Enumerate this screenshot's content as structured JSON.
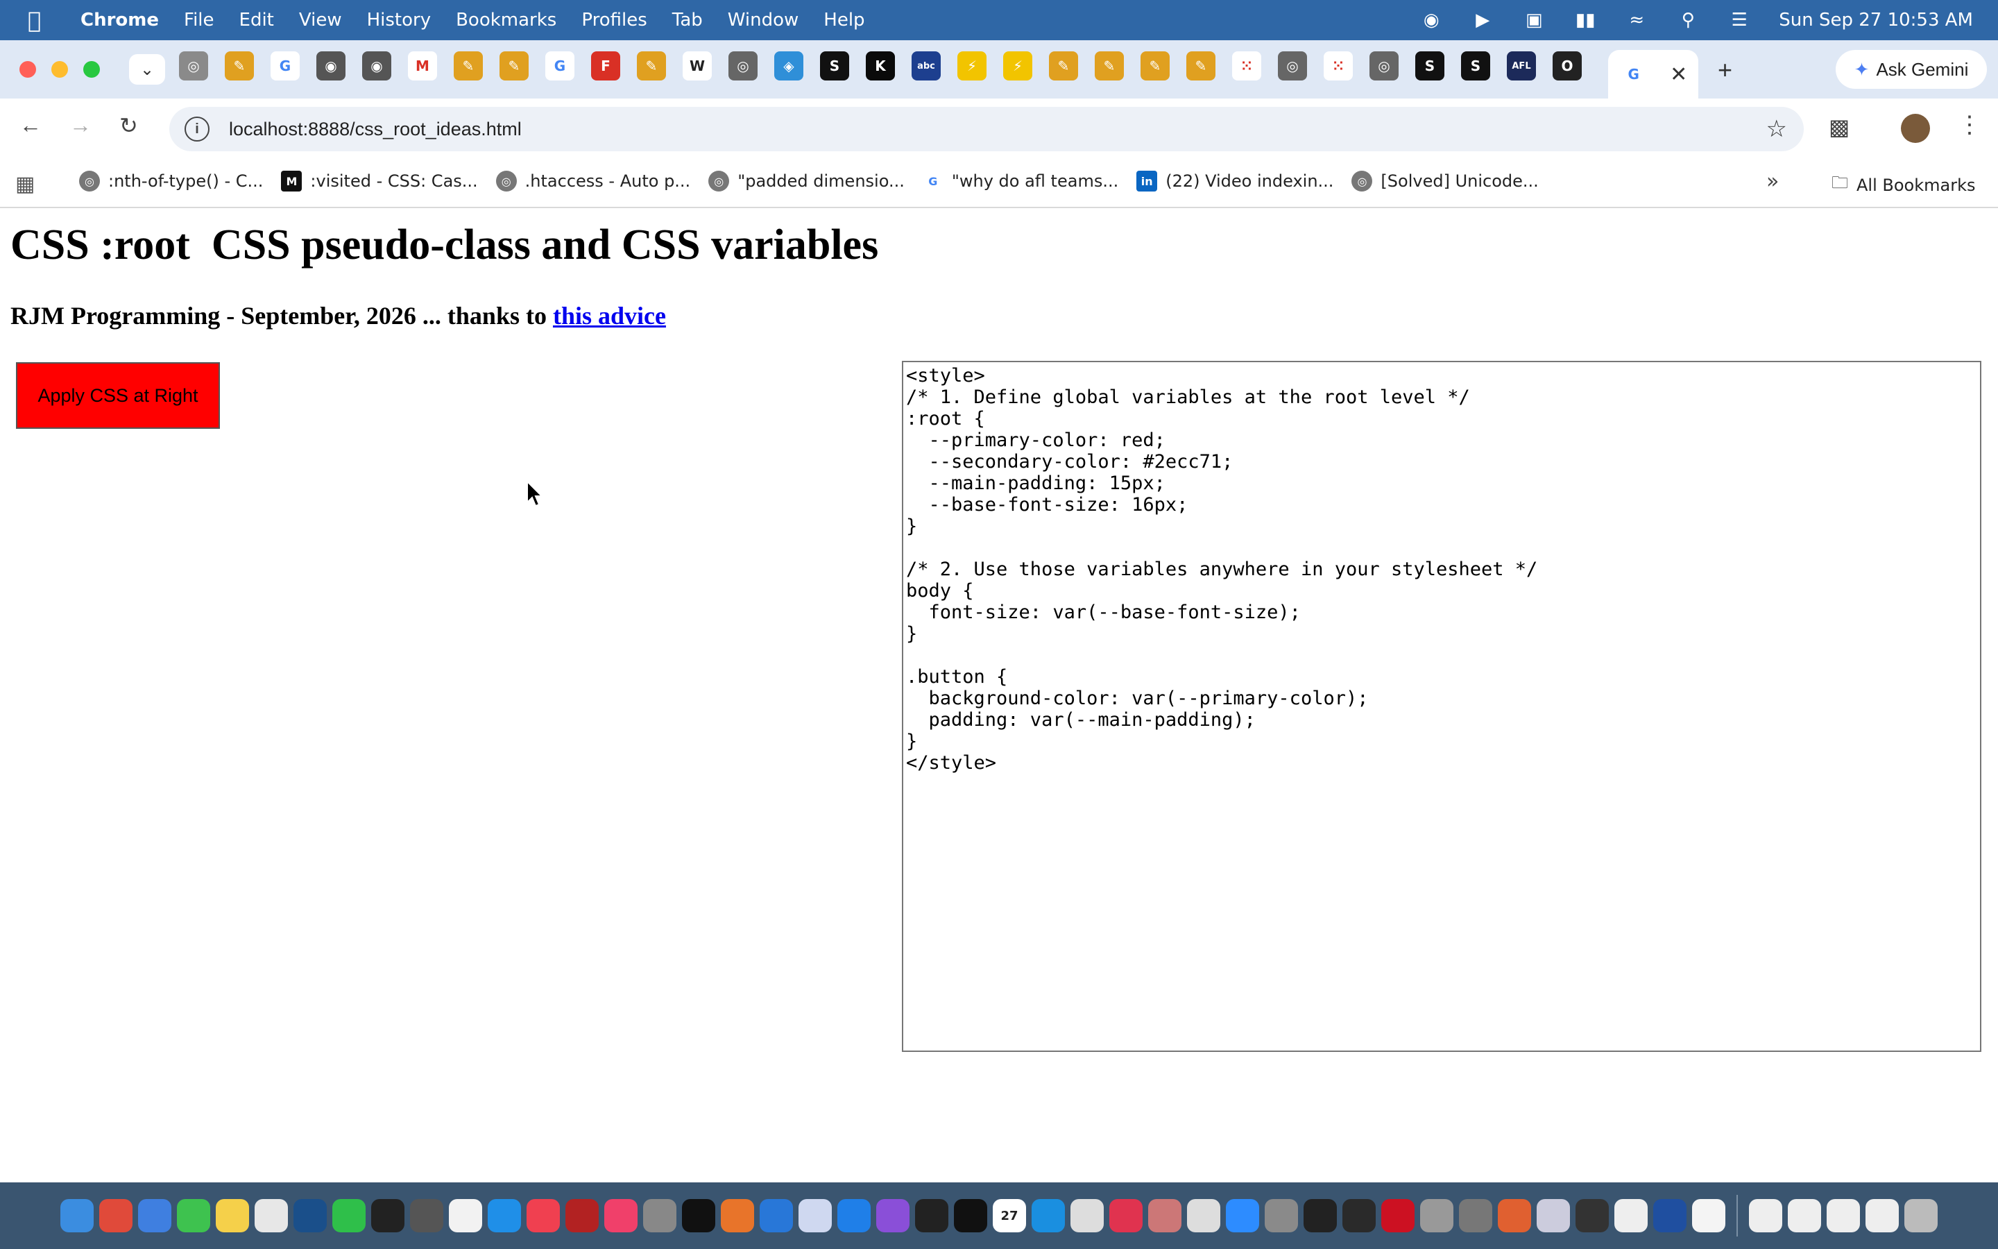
{
  "menubar": {
    "app_name": "Chrome",
    "items": [
      "File",
      "Edit",
      "View",
      "History",
      "Bookmarks",
      "Profiles",
      "Tab",
      "Window",
      "Help"
    ],
    "clock": "Sun Sep 27  10:53 AM"
  },
  "tabs": {
    "favicons": [
      "globe",
      "pencil",
      "G",
      "shield",
      "shield",
      "M",
      "pencil",
      "pencil",
      "G",
      "F",
      "pencil",
      "W",
      "chrome",
      "diamond",
      "S",
      "K",
      "abc",
      "bolt",
      "bolt",
      "pencil",
      "pencil",
      "pencil",
      "pencil",
      "dots",
      "chrome",
      "dots",
      "chrome",
      "S",
      "S",
      "AFL",
      "O",
      "G"
    ],
    "ask_gemini_label": "Ask Gemini"
  },
  "toolbar": {
    "url": "localhost:8888/css_root_ideas.html"
  },
  "bookmarks": {
    "items": [
      {
        "icon": "globe",
        "label": ":nth-of-type() - C..."
      },
      {
        "icon": "M",
        "label": ":visited - CSS: Cas..."
      },
      {
        "icon": "globe",
        "label": ".htaccess - Auto p..."
      },
      {
        "icon": "globe",
        "label": "\"padded dimensio..."
      },
      {
        "icon": "G",
        "label": "\"why do afl teams..."
      },
      {
        "icon": "in",
        "label": "(22) Video indexin..."
      },
      {
        "icon": "globe",
        "label": "[Solved] Unicode..."
      }
    ],
    "all_bookmarks_label": "All Bookmarks"
  },
  "page": {
    "title": "CSS :root  CSS pseudo-class and CSS variables",
    "byline_prefix": "RJM Programming - September, 2026 ... thanks to ",
    "byline_link": "this advice",
    "apply_button_label": "Apply CSS at Right",
    "css_textarea_value": "<style>\n/* 1. Define global variables at the root level */\n:root {\n  --primary-color: red;\n  --secondary-color: #2ecc71;\n  --main-padding: 15px;\n  --base-font-size: 16px;\n}\n\n/* 2. Use those variables anywhere in your stylesheet */\nbody {\n  font-size: var(--base-font-size);\n}\n\n.button {\n  background-color: var(--primary-color);\n  padding: var(--main-padding);\n}\n</style>"
  },
  "dock": {
    "icons": [
      "finder",
      "launchpad",
      "mail",
      "messages",
      "notes",
      "reminders",
      "freeform",
      "facetime",
      "terminal-exec",
      "calculator",
      "textedit",
      "appstore",
      "news",
      "filezilla",
      "music",
      "preview",
      "appletv",
      "firefox",
      "xcode",
      "bbedit",
      "safari",
      "podcasts",
      "exec",
      "terminal",
      "calendar",
      "quicktime",
      "files",
      "intellij",
      "photos-edit",
      "chrome",
      "zoom",
      "system-settings",
      "inkscape",
      "davinci",
      "opera",
      "contacts",
      "gimp",
      "pinwheel",
      "no-entry",
      "keyboard",
      "photos",
      "quicktime-2",
      "doc",
      "window-1",
      "window-2",
      "window-3",
      "window-4",
      "trash"
    ],
    "calendar_day": "27"
  },
  "colors": {
    "menubar": "#2f67a6",
    "tabstrip": "#dfe8f5",
    "apply_button_bg": "#ff0000",
    "link": "#0000ee"
  }
}
